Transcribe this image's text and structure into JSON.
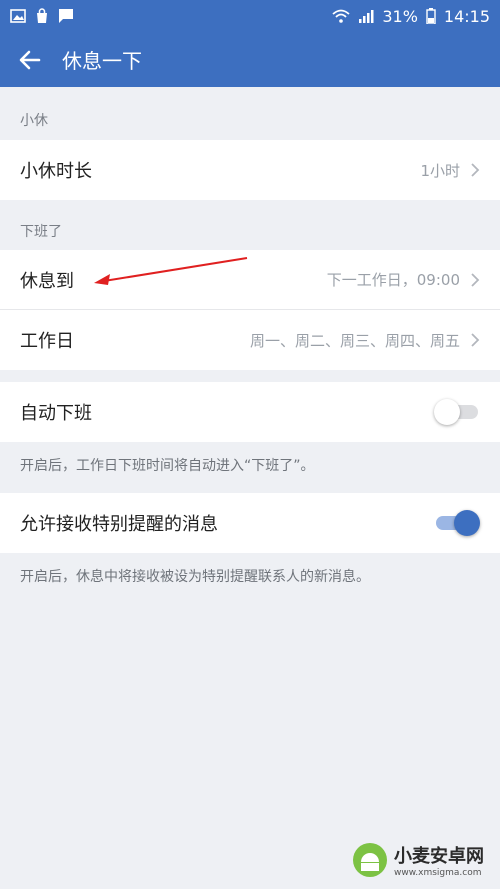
{
  "status_bar": {
    "battery": "31%",
    "time": "14:15"
  },
  "app_bar": {
    "title": "休息一下"
  },
  "sections": {
    "short_break": {
      "label": "小休",
      "rows": [
        {
          "title": "小休时长",
          "value": "1小时"
        }
      ]
    },
    "off_work": {
      "label": "下班了",
      "rows": [
        {
          "title": "休息到",
          "value": "下一工作日，09:00"
        },
        {
          "title": "工作日",
          "value": "周一、周二、周三、周四、周五"
        }
      ]
    },
    "auto_off": {
      "title": "自动下班",
      "enabled": false,
      "description": "开启后，工作日下班时间将自动进入“下班了”。"
    },
    "allow_special": {
      "title": "允许接收特别提醒的消息",
      "enabled": true,
      "description": "开启后，休息中将接收被设为特别提醒联系人的新消息。"
    }
  },
  "colors": {
    "primary": "#3d6fc0",
    "annotation_arrow": "#e02020"
  },
  "watermark": {
    "name": "小麦安卓网",
    "url": "www.xmsigma.com"
  }
}
